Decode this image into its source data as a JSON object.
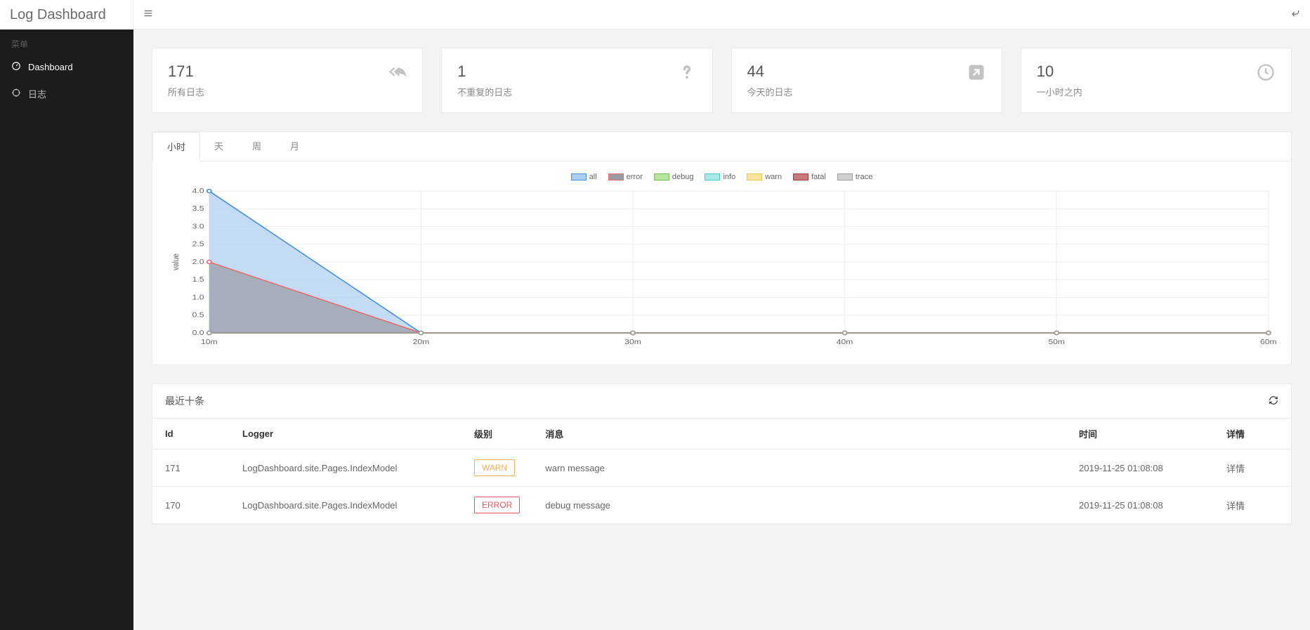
{
  "brand": "Log Dashboard",
  "sidebar": {
    "section_label": "菜单",
    "items": [
      {
        "label": "Dashboard",
        "icon": "gauge-icon",
        "active": true
      },
      {
        "label": "日志",
        "icon": "crosshair-icon",
        "active": false
      }
    ]
  },
  "cards": [
    {
      "value": "171",
      "label": "所有日志",
      "icon": "reply-all-icon"
    },
    {
      "value": "1",
      "label": "不重复的日志",
      "icon": "question-icon"
    },
    {
      "value": "44",
      "label": "今天的日志",
      "icon": "arrow-out-icon"
    },
    {
      "value": "10",
      "label": "一小时之内",
      "icon": "clock-icon"
    }
  ],
  "tabs": [
    {
      "label": "小时",
      "active": true
    },
    {
      "label": "天",
      "active": false
    },
    {
      "label": "周",
      "active": false
    },
    {
      "label": "月",
      "active": false
    }
  ],
  "chart_data": {
    "type": "area",
    "ylabel": "value",
    "ylim": [
      0,
      4
    ],
    "yticks": [
      0,
      0.5,
      1.0,
      1.5,
      2.0,
      2.5,
      3.0,
      3.5,
      4.0
    ],
    "x_categories": [
      "10m",
      "20m",
      "30m",
      "40m",
      "50m",
      "60m"
    ],
    "legend": [
      "all",
      "error",
      "debug",
      "info",
      "warn",
      "fatal",
      "trace"
    ],
    "series": [
      {
        "name": "all",
        "color_fill": "#a9cdef",
        "color_stroke": "#4a90d9",
        "values": [
          4,
          0,
          0,
          0,
          0,
          0
        ]
      },
      {
        "name": "error",
        "color_fill": "#9a9aa3",
        "color_stroke": "#e86c6c",
        "values": [
          2,
          0,
          0,
          0,
          0,
          0
        ]
      },
      {
        "name": "debug",
        "color_fill": "#b7e4a1",
        "color_stroke": "#6fc24a",
        "values": [
          0,
          0,
          0,
          0,
          0,
          0
        ]
      },
      {
        "name": "info",
        "color_fill": "#a8e8e8",
        "color_stroke": "#45c9c9",
        "values": [
          0,
          0,
          0,
          0,
          0,
          0
        ]
      },
      {
        "name": "warn",
        "color_fill": "#f9e29b",
        "color_stroke": "#e9c84a",
        "values": [
          0,
          0,
          0,
          0,
          0,
          0
        ]
      },
      {
        "name": "fatal",
        "color_fill": "#c97b7b",
        "color_stroke": "#a33a3a",
        "values": [
          0,
          0,
          0,
          0,
          0,
          0
        ]
      },
      {
        "name": "trace",
        "color_fill": "#d0d0d0",
        "color_stroke": "#9e9e9e",
        "values": [
          0,
          0,
          0,
          0,
          0,
          0
        ]
      }
    ]
  },
  "recent": {
    "title": "最近十条",
    "columns": {
      "id": "Id",
      "logger": "Logger",
      "level": "级别",
      "message": "消息",
      "time": "时间",
      "detail": "详情"
    },
    "detail_link_label": "详情",
    "rows": [
      {
        "id": "171",
        "logger": "LogDashboard.site.Pages.IndexModel",
        "level": "WARN",
        "level_class": "warn",
        "message": "warn message",
        "time": "2019-11-25 01:08:08"
      },
      {
        "id": "170",
        "logger": "LogDashboard.site.Pages.IndexModel",
        "level": "ERROR",
        "level_class": "error",
        "message": "debug message",
        "time": "2019-11-25 01:08:08"
      }
    ]
  }
}
